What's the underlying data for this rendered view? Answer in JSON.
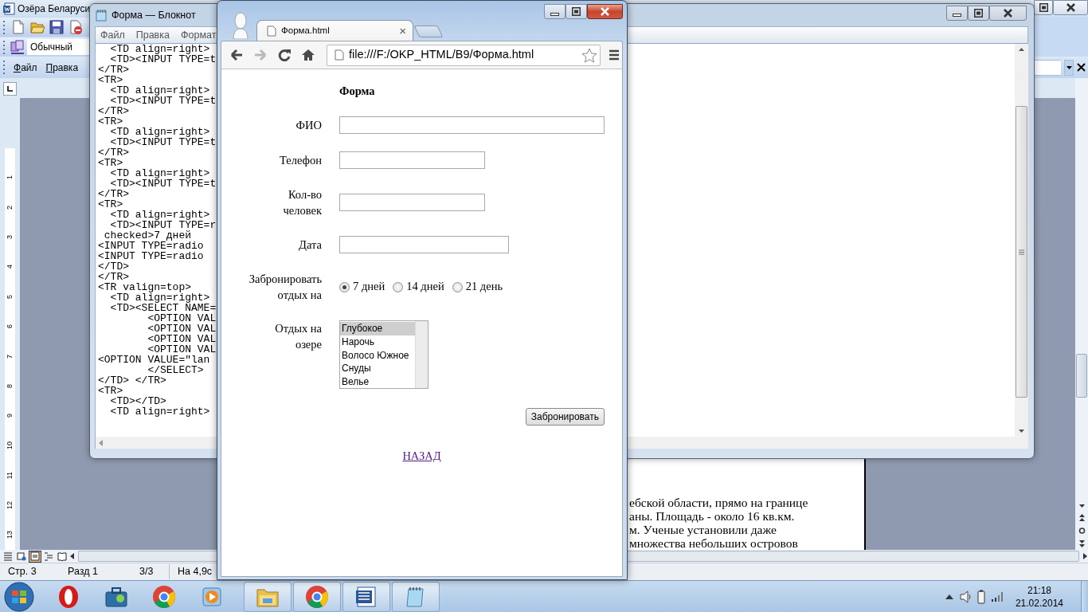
{
  "word": {
    "title": "Озёра Беларуси",
    "style_box": "Обычный",
    "menu": [
      "Файл",
      "Правка"
    ],
    "ruler": [
      "1",
      "2",
      "3",
      "4",
      "5",
      "6",
      "7",
      "8",
      "9",
      "10",
      "11",
      "12",
      "13"
    ],
    "document_lines": [
      "ебской области, прямо на границе",
      "аны. Площадь - около 16 кв.км.",
      "м. Ученые установили даже",
      "множества небольших островов"
    ],
    "views": [
      {
        "selected": false
      },
      {
        "selected": false
      },
      {
        "selected": true
      },
      {
        "selected": false
      },
      {
        "selected": false
      }
    ],
    "status": [
      "Стр. 3",
      "Разд 1",
      "3/3",
      "На 4,9с"
    ]
  },
  "notepad": {
    "title": "Форма — Блокнот",
    "menu": [
      "Файл",
      "Правка",
      "Формат"
    ],
    "lines": [
      "  <TD align=right>",
      "  <TD><INPUT TYPE=t",
      "</TR>",
      "<TR>",
      "  <TD align=right>",
      "  <TD><INPUT TYPE=t",
      "</TR>",
      "<TR>",
      "  <TD align=right>",
      "  <TD><INPUT TYPE=t",
      "</TR>",
      "<TR>",
      "  <TD align=right>",
      "  <TD><INPUT TYPE=t",
      "</TR>",
      "<TR>",
      "  <TD align=right>",
      "  <TD><INPUT TYPE=r",
      " checked>7 дней",
      "<INPUT TYPE=radio",
      "<INPUT TYPE=radio",
      "</TD>",
      "</TR>",
      "<TR valign=top>",
      "  <TD align=right>",
      "  <TD><SELECT NAME=",
      "        <OPTION VAL",
      "        <OPTION VAL",
      "        <OPTION VAL",
      "        <OPTION VAL",
      "<OPTION VALUE=\"lan",
      "        </SELECT>",
      "</TD> </TR>",
      "<TR>",
      "  <TD></TD>",
      "  <TD align=right>"
    ]
  },
  "browser": {
    "tab": {
      "title": "Форма.html",
      "close": "×"
    },
    "nav": [
      {
        "kind": "back",
        "disabled": false
      },
      {
        "kind": "forward",
        "disabled": true
      },
      {
        "kind": "reload",
        "disabled": false
      },
      {
        "kind": "home",
        "disabled": false
      }
    ],
    "address": "file:///F:/OKP_HTML/B9/Форма.html",
    "page": {
      "heading": "Форма",
      "fields": [
        {
          "kind": "text",
          "label": "ФИО"
        },
        {
          "kind": "text",
          "label": "Телефон"
        },
        {
          "kind": "text",
          "label": "Кол-во\nчеловек"
        },
        {
          "kind": "text",
          "label": "Дата"
        },
        {
          "kind": "radio",
          "label": "Забронировать\nотдых на",
          "options": [
            {
              "label": "7 дней",
              "selected": true
            },
            {
              "label": "14 дней",
              "selected": false
            },
            {
              "label": "21 день",
              "selected": false
            }
          ]
        },
        {
          "kind": "listbox",
          "label": "Отдых на\nозере",
          "options": [
            {
              "label": "Глубокое",
              "selected": true
            },
            {
              "label": "Нарочь",
              "selected": false
            },
            {
              "label": "Волосо Южное",
              "selected": false
            },
            {
              "label": "Снуды",
              "selected": false
            },
            {
              "label": "Велье",
              "selected": false
            }
          ]
        }
      ],
      "submit": "Забронировать",
      "link": "НАЗАД"
    }
  },
  "taskbar": {
    "apps": [
      {
        "kind": "opera",
        "running": false
      },
      {
        "kind": "toolbox",
        "running": false
      },
      {
        "kind": "chrome",
        "running": false
      },
      {
        "kind": "player",
        "running": false
      },
      {
        "kind": "folder",
        "running": true
      },
      {
        "kind": "chrome",
        "running": true
      },
      {
        "kind": "word",
        "running": true
      },
      {
        "kind": "notepad",
        "running": true
      }
    ],
    "time": "21:18",
    "date": "21.02.2014"
  }
}
